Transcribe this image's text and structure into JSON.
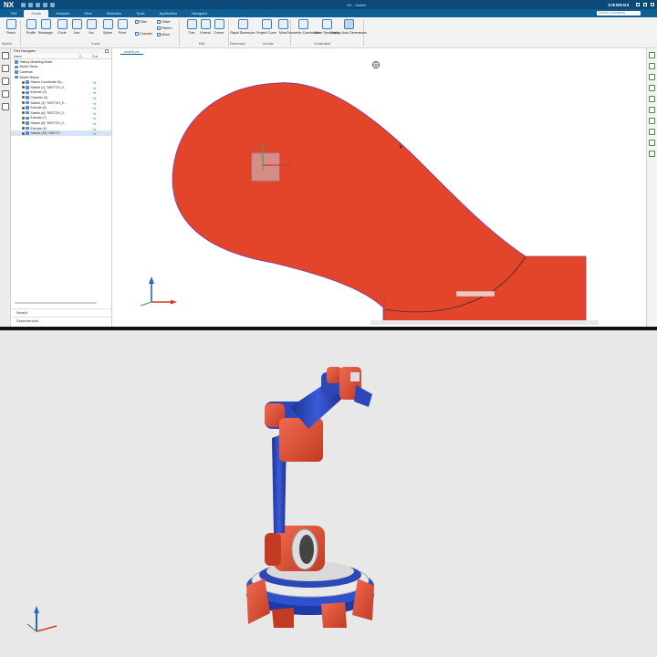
{
  "app": {
    "logo": "NX",
    "window_title": "NX - Sketch",
    "brand": "SIEMENS"
  },
  "ribbon_tabs": [
    "File",
    "Home",
    "Analysis",
    "View",
    "Selection",
    "Tools",
    "Application",
    "Navigator"
  ],
  "active_tab_index": 1,
  "search_placeholder": "Search Commands",
  "ribbon": {
    "buttons": [
      {
        "id": "finish",
        "label": "Finish"
      },
      {
        "id": "profile",
        "label": "Profile"
      },
      {
        "id": "rectangle",
        "label": "Rectangle"
      },
      {
        "id": "circle",
        "label": "Circle"
      },
      {
        "id": "line",
        "label": "Line"
      },
      {
        "id": "arc",
        "label": "Arc"
      },
      {
        "id": "spline",
        "label": "Spline"
      },
      {
        "id": "point",
        "label": "Point"
      },
      {
        "id": "trim",
        "label": "Trim"
      },
      {
        "id": "extend",
        "label": "Extend"
      },
      {
        "id": "corner",
        "label": "Corner"
      },
      {
        "id": "rapid-dimension",
        "label": "Rapid Dimension"
      },
      {
        "id": "project-curve",
        "label": "Project Curve"
      },
      {
        "id": "more",
        "label": "More"
      },
      {
        "id": "geometric-constraints",
        "label": "Geometric Constraints"
      },
      {
        "id": "make-symmetric",
        "label": "Make Symmetric"
      },
      {
        "id": "display-auto-dimensions",
        "label": "Display Auto Dimensions"
      }
    ],
    "small_buttons": {
      "fillet": "Fillet",
      "chamfer": "Chamfer",
      "offset": "Offset",
      "pattern": "Pattern",
      "mirror": "Mirror"
    },
    "groups": {
      "sketch": "Sketch",
      "curve": "Curve",
      "edit": "Edit",
      "dimension": "Dimension",
      "include": "Include",
      "constraints": "Constraints"
    }
  },
  "navigator": {
    "title": "Part Navigator",
    "columns": [
      "Name",
      "C...",
      "Curr"
    ],
    "rows": [
      {
        "label": "History Modeling Mode",
        "indent": 1
      },
      {
        "label": "Model Views",
        "indent": 1
      },
      {
        "label": "Cameras",
        "indent": 1
      },
      {
        "label": "Model History",
        "indent": 1
      },
      {
        "label": "Datum Coordinate Sy...",
        "indent": 2,
        "check": true
      },
      {
        "label": "Sketch (1) \"SKETCH_0...",
        "indent": 2,
        "check": true
      },
      {
        "label": "Extrude (2)",
        "indent": 2,
        "check": true
      },
      {
        "label": "Chamfer (3)",
        "indent": 2,
        "check": true
      },
      {
        "label": "Sketch (4) \"SKETCH_0...",
        "indent": 2,
        "check": true
      },
      {
        "label": "Extrude (5)",
        "indent": 2,
        "check": true
      },
      {
        "label": "Sketch (6) \"SKETCH_0...",
        "indent": 2,
        "check": true
      },
      {
        "label": "Extrude (7)",
        "indent": 2,
        "check": true
      },
      {
        "label": "Sketch (8) \"SKETCH_0...",
        "indent": 2,
        "check": true
      },
      {
        "label": "Extrude (9)",
        "indent": 2,
        "check": true
      },
      {
        "label": "Sketch (10) \"SKETC...",
        "indent": 2,
        "check": true,
        "selected": true
      }
    ],
    "bottom_links": [
      "Search",
      "Dependencies"
    ]
  },
  "graphics": {
    "tab_label": "model1.prt",
    "shape_color": "#e2452a"
  },
  "bottom_view": {
    "robot_red": "#e0472e",
    "robot_blue": "#2c48b8",
    "background": "#e8e8e8"
  },
  "icons": [
    "search-icon",
    "close-icon",
    "check-icon",
    "triad-icon",
    "eye-icon"
  ]
}
